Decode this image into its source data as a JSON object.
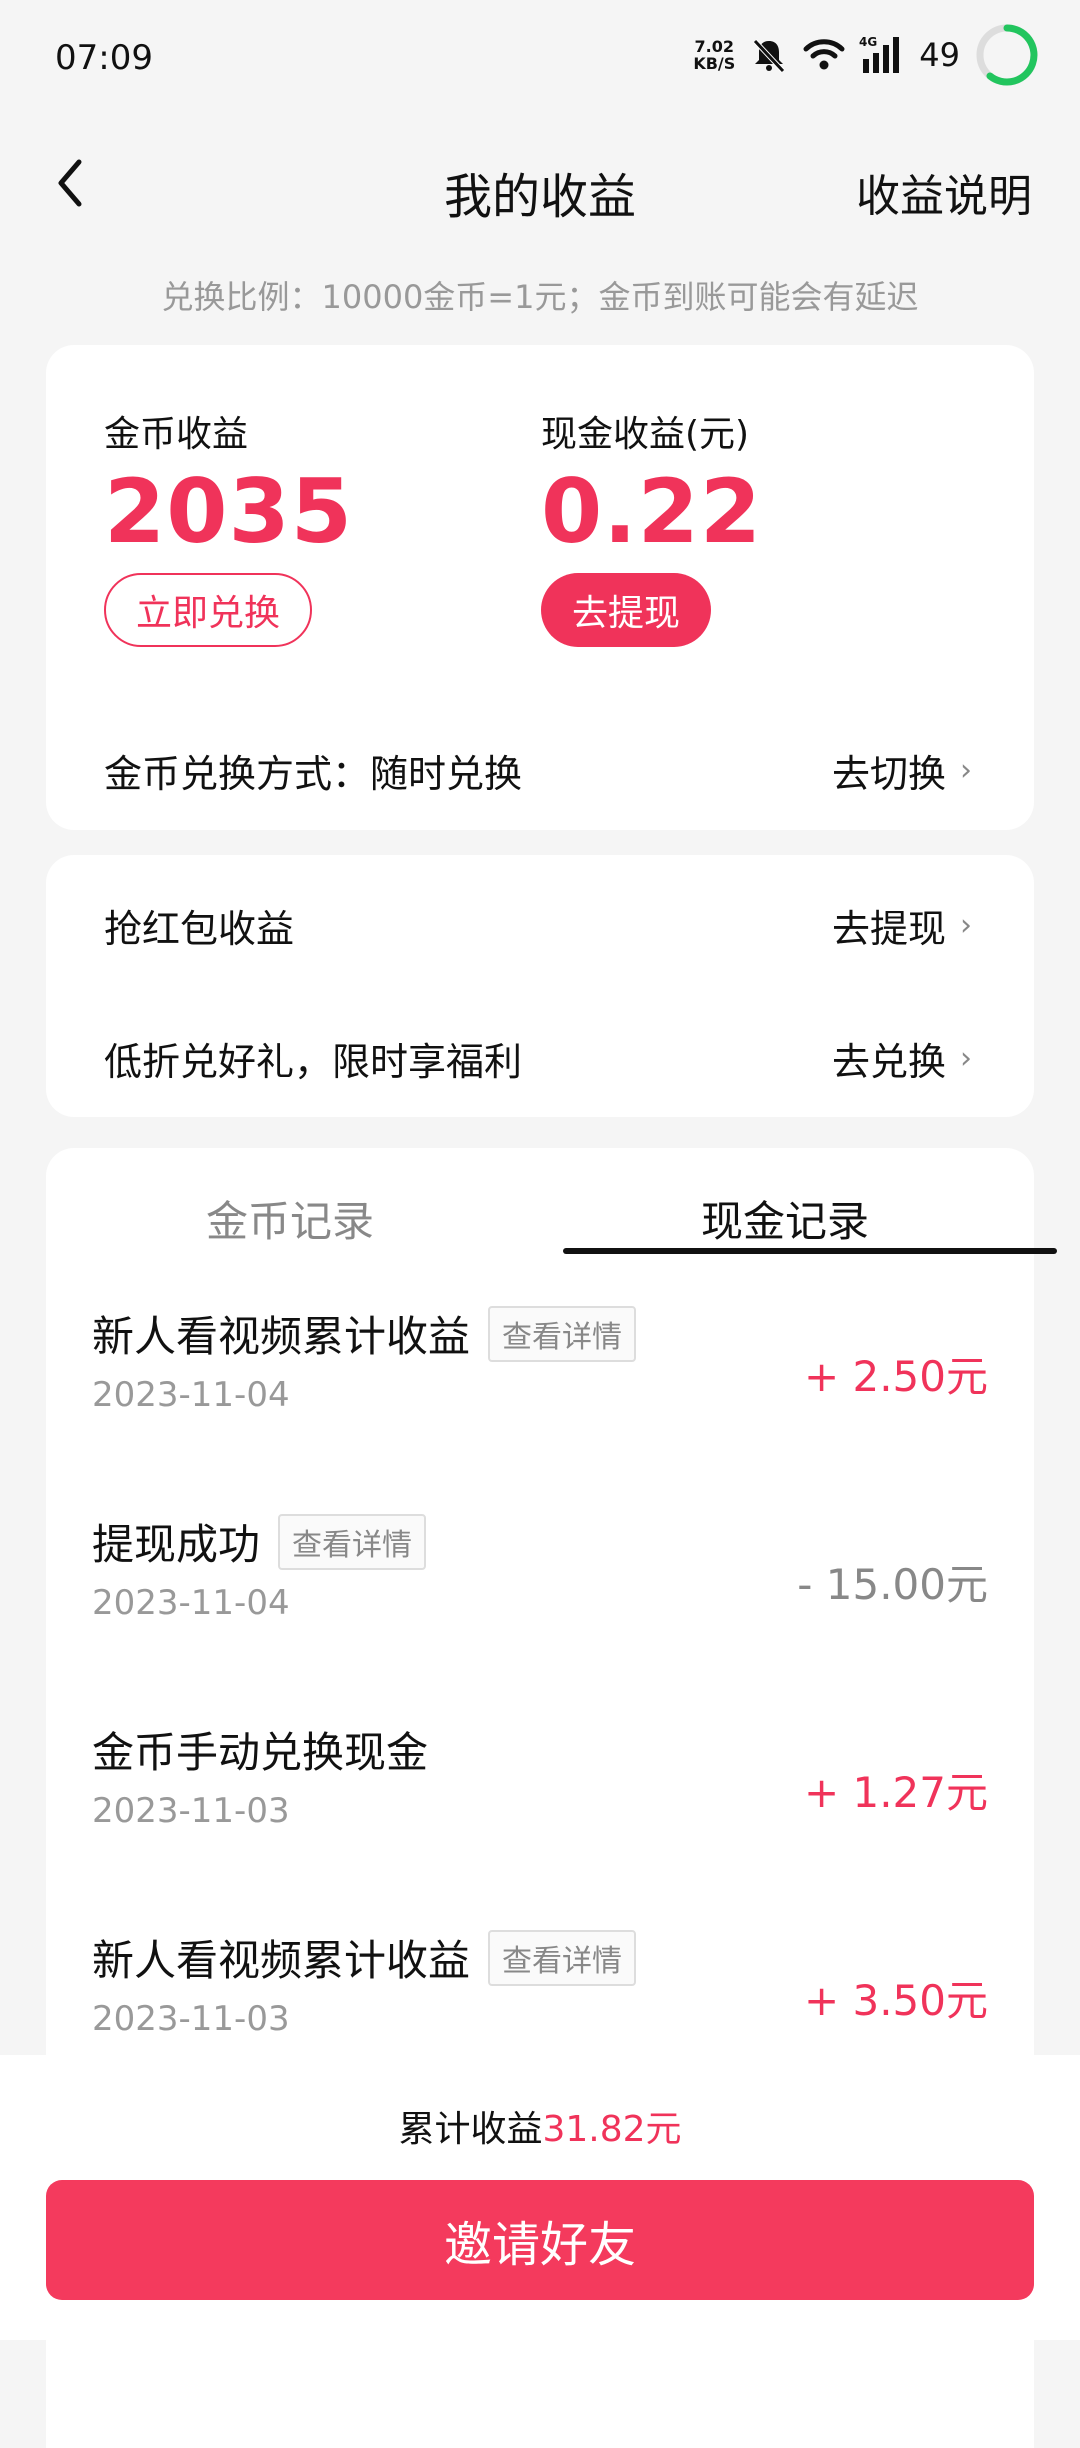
{
  "status_bar": {
    "time": "07:09",
    "net_speed_value": "7.02",
    "net_speed_unit": "KB/S",
    "network_type": "4G",
    "battery": "49",
    "icons": [
      "mute-bell-icon",
      "wifi-icon",
      "signal-icon",
      "battery-ring-icon"
    ]
  },
  "header": {
    "title": "我的收益",
    "info_link": "收益说明"
  },
  "exchange_note": "兑换比例：10000金币=1元；金币到账可能会有延迟",
  "earnings": {
    "coin_label": "金币收益",
    "coin_value": "2035",
    "coin_button": "立即兑换",
    "cash_label": "现金收益(元)",
    "cash_value": "0.22",
    "cash_button": "去提现",
    "method_label": "金币兑换方式：随时兑换",
    "method_action": "去切换"
  },
  "links": [
    {
      "label": "抢红包收益",
      "action": "去提现"
    },
    {
      "label": "低折兑好礼，限时享福利",
      "action": "去兑换"
    }
  ],
  "tabs": [
    {
      "label": "金币记录",
      "active": false
    },
    {
      "label": "现金记录",
      "active": true
    }
  ],
  "records": [
    {
      "title": "新人看视频累计收益",
      "tag": "查看详情",
      "date": "2023-11-04",
      "amount": "+ 2.50元",
      "sign": "plus"
    },
    {
      "title": "提现成功",
      "tag": "查看详情",
      "date": "2023-11-04",
      "amount": "-  15.00元",
      "sign": "minus"
    },
    {
      "title": "金币手动兑换现金",
      "tag": "",
      "date": "2023-11-03",
      "amount": "+ 1.27元",
      "sign": "plus"
    },
    {
      "title": "新人看视频累计收益",
      "tag": "查看详情",
      "date": "2023-11-03",
      "amount": "+ 3.50元",
      "sign": "plus"
    }
  ],
  "footer": {
    "total_label": "累计收益",
    "total_value": "31.82元",
    "invite_button": "邀请好友"
  },
  "colors": {
    "accent": "#f0335a",
    "invite_button": "#f43a5d",
    "battery_ring": "#22c55e"
  }
}
